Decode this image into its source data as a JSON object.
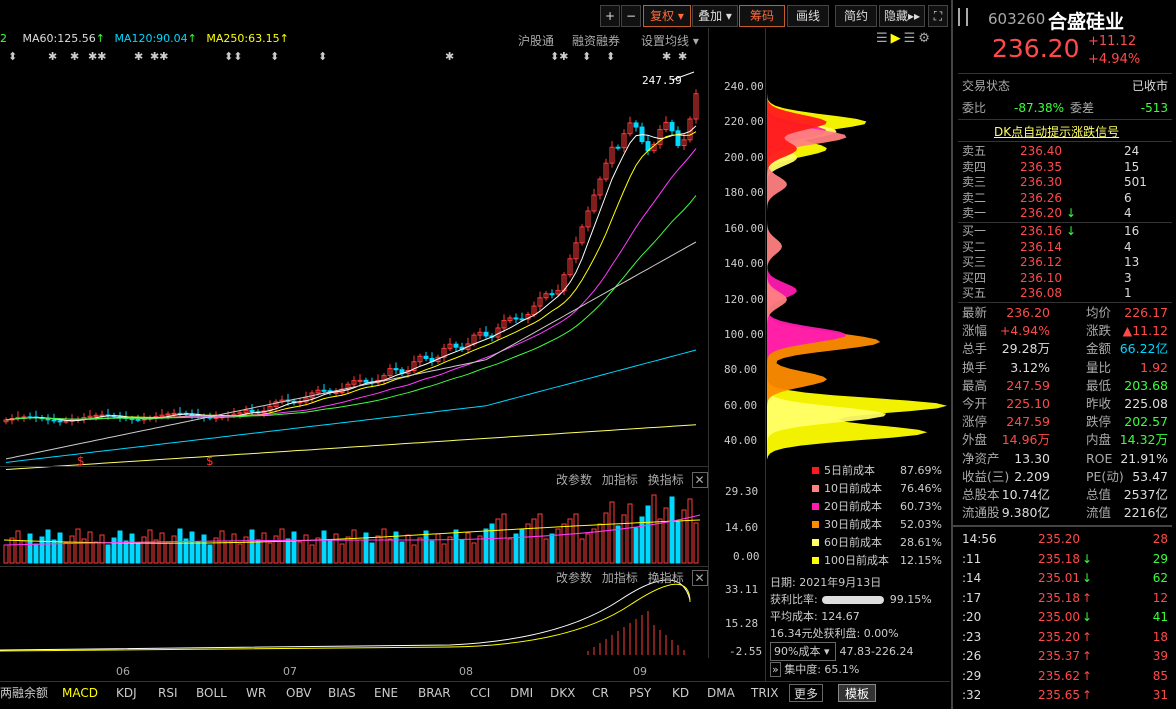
{
  "toolbar": {
    "plus": "+",
    "minus": "−",
    "fuquan": "复权",
    "diejia": "叠加",
    "chouma": "筹码",
    "huaxian": "画线",
    "jianyue": "简约",
    "yincang": "隐藏"
  },
  "ma_line": {
    "ma_left": "2",
    "ma60": "MA60:125.56",
    "ma120": "MA120:90.04",
    "ma250": "MA250:63.15"
  },
  "top_links": {
    "hgt": "沪股通",
    "rzrq": "融资融券",
    "szjx": "设置均线"
  },
  "header": {
    "code": "603260",
    "name": "合盛硅业",
    "price": "236.20",
    "chg": "+11.12",
    "pct": "+4.94%"
  },
  "status": {
    "label": "交易状态",
    "value": "已收市"
  },
  "weibi": {
    "l1": "委比",
    "v1": "-87.38%",
    "l2": "委差",
    "v2": "-513"
  },
  "dk_link": "DK点自动提示涨跌信号",
  "sells": [
    {
      "l": "卖五",
      "p": "236.40",
      "v": "24"
    },
    {
      "l": "卖四",
      "p": "236.35",
      "v": "15"
    },
    {
      "l": "卖三",
      "p": "236.30",
      "v": "501"
    },
    {
      "l": "卖二",
      "p": "236.26",
      "v": "6"
    },
    {
      "l": "卖一",
      "p": "236.20",
      "v": "4",
      "arrow": "down"
    }
  ],
  "buys": [
    {
      "l": "买一",
      "p": "236.16",
      "v": "16",
      "arrow": "down"
    },
    {
      "l": "买二",
      "p": "236.14",
      "v": "4"
    },
    {
      "l": "买三",
      "p": "236.12",
      "v": "13"
    },
    {
      "l": "买四",
      "p": "236.10",
      "v": "3"
    },
    {
      "l": "买五",
      "p": "236.08",
      "v": "1"
    }
  ],
  "stats": [
    {
      "a": "最新",
      "b": "236.20",
      "c": "均价",
      "d": "226.17",
      "bc": "red",
      "dc": "red"
    },
    {
      "a": "涨幅",
      "b": "+4.94%",
      "c": "涨跌",
      "d": "▲11.12",
      "bc": "red",
      "dc": "red"
    },
    {
      "a": "总手",
      "b": "29.28万",
      "c": "金额",
      "d": "66.22亿",
      "bc": "wht",
      "dc": "cyn"
    },
    {
      "a": "换手",
      "b": "3.12%",
      "c": "量比",
      "d": "1.92",
      "bc": "wht",
      "dc": "red"
    },
    {
      "a": "最高",
      "b": "247.59",
      "c": "最低",
      "d": "203.68",
      "bc": "red",
      "dc": "grn"
    },
    {
      "a": "今开",
      "b": "225.10",
      "c": "昨收",
      "d": "225.08",
      "bc": "red",
      "dc": "wht"
    },
    {
      "a": "涨停",
      "b": "247.59",
      "c": "跌停",
      "d": "202.57",
      "bc": "red",
      "dc": "grn"
    },
    {
      "a": "外盘",
      "b": "14.96万",
      "c": "内盘",
      "d": "14.32万",
      "bc": "red",
      "dc": "grn"
    },
    {
      "a": "净资产",
      "b": "13.30",
      "c": "ROE",
      "d": "21.91%",
      "bc": "wht",
      "dc": "wht"
    },
    {
      "a": "收益(三)",
      "b": "2.209",
      "c": "PE(动)",
      "d": "53.47",
      "bc": "wht",
      "dc": "wht"
    },
    {
      "a": "总股本",
      "b": "10.74亿",
      "c": "总值",
      "d": "2537亿",
      "bc": "wht",
      "dc": "wht"
    },
    {
      "a": "流通股",
      "b": "9.380亿",
      "c": "流值",
      "d": "2216亿",
      "bc": "wht",
      "dc": "wht"
    }
  ],
  "ticks": [
    {
      "t": "14:56",
      "p": "235.20",
      "v": "28",
      "a": ""
    },
    {
      "t": ":11",
      "p": "235.18",
      "v": "29",
      "a": "down"
    },
    {
      "t": ":14",
      "p": "235.01",
      "v": "62",
      "a": "down"
    },
    {
      "t": ":17",
      "p": "235.18",
      "v": "12",
      "a": "up"
    },
    {
      "t": ":20",
      "p": "235.00",
      "v": "41",
      "a": "down"
    },
    {
      "t": ":23",
      "p": "235.20",
      "v": "18",
      "a": "up"
    },
    {
      "t": ":26",
      "p": "235.37",
      "v": "39",
      "a": "up"
    },
    {
      "t": ":29",
      "p": "235.62",
      "v": "85",
      "a": "up"
    },
    {
      "t": ":32",
      "p": "235.65",
      "v": "31",
      "a": "up"
    }
  ],
  "price_axis": [
    "240.00",
    "220.00",
    "200.00",
    "180.00",
    "160.00",
    "140.00",
    "120.00",
    "100.00",
    "80.00",
    "60.00",
    "40.00"
  ],
  "vol_axis": [
    "29.30",
    "14.60",
    "0.00"
  ],
  "macd_axis": [
    "33.11",
    "15.28",
    "-2.55"
  ],
  "hi_label": "247.59",
  "sub_links": {
    "gcs": "改参数",
    "jzb": "加指标",
    "hzb": "换指标"
  },
  "months": [
    "06",
    "07",
    "08",
    "09"
  ],
  "chip_legend": [
    {
      "l": "5日前成本",
      "v": "87.69%",
      "c": "#ff1a1a"
    },
    {
      "l": "10日前成本",
      "v": "76.46%",
      "c": "#ff8080"
    },
    {
      "l": "20日前成本",
      "v": "60.73%",
      "c": "#ff1ab0"
    },
    {
      "l": "30日前成本",
      "v": "52.03%",
      "c": "#ff8c00"
    },
    {
      "l": "60日前成本",
      "v": "28.61%",
      "c": "#ffff66"
    },
    {
      "l": "100日前成本",
      "v": "12.15%",
      "c": "#ffff00"
    }
  ],
  "chip_info": {
    "date": "日期: 2021年9月13日",
    "ratio_l": "获利比率:",
    "ratio_v": "99.15%",
    "avg": "平均成本: 124.67",
    "profit": "16.34元处获利盘: 0.00%",
    "sel": "90%成本",
    "range": "47.83-226.24",
    "conc": "集中度: 65.1%"
  },
  "tabs": [
    "两融余额",
    "MACD",
    "KDJ",
    "RSI",
    "BOLL",
    "WR",
    "OBV",
    "BIAS",
    "ENE",
    "BRAR",
    "CCI",
    "DMI",
    "DKX",
    "CR",
    "PSY",
    "KD",
    "DMA",
    "TRIX",
    "更多",
    "模板"
  ]
}
